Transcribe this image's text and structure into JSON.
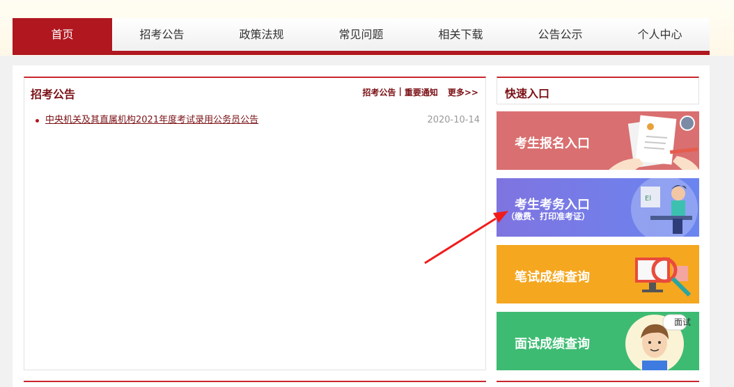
{
  "nav": {
    "items": [
      {
        "label": "首页",
        "active": true
      },
      {
        "label": "招考公告"
      },
      {
        "label": "政策法规"
      },
      {
        "label": "常见问题"
      },
      {
        "label": "相关下载"
      },
      {
        "label": "公告公示"
      },
      {
        "label": "个人中心"
      }
    ]
  },
  "announcements": {
    "title": "招考公告",
    "links": {
      "recruit": "招考公告",
      "sep": "|",
      "notice": "重要通知",
      "more": "更多>>"
    },
    "items": [
      {
        "title": "中央机关及其直属机构2021年度考试录用公务员公告",
        "date": "2020-10-14"
      }
    ]
  },
  "quick": {
    "title": "快速入口",
    "buttons": [
      {
        "label": "考生报名入口",
        "color": "#d96f70"
      },
      {
        "label": "考生考务入口",
        "sub": "（缴费、打印准考证）",
        "color": "#7a7ce8"
      },
      {
        "label": "笔试成绩查询",
        "color": "#f5a720"
      },
      {
        "label": "面试成绩查询",
        "badge": "面试",
        "color": "#3dbb72"
      }
    ]
  },
  "colors": {
    "brand_red": "#b0171f",
    "title_red": "#7a1015"
  }
}
